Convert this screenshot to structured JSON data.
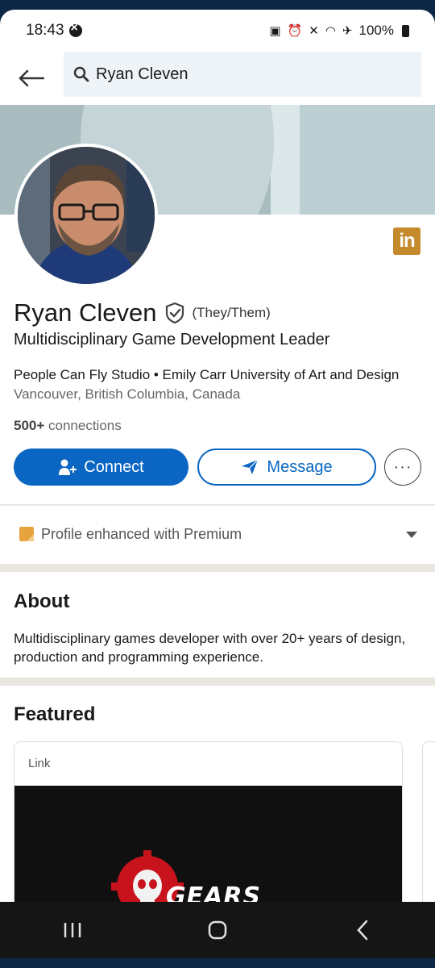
{
  "status_bar": {
    "time": "18:43",
    "battery": "100%"
  },
  "search": {
    "query": "Ryan Cleven"
  },
  "profile": {
    "name": "Ryan Cleven",
    "pronouns": "(They/Them)",
    "headline": "Multidisciplinary Game Development Leader",
    "work": "People Can Fly Studio • Emily Carr University of Art and Design",
    "location": "Vancouver, British Columbia, Canada",
    "connections_count": "500+",
    "connections_label": " connections",
    "linkedin_badge": "in"
  },
  "actions": {
    "connect_label": "Connect",
    "message_label": "Message",
    "more_label": "···"
  },
  "premium": {
    "label": "Profile enhanced with Premium"
  },
  "about": {
    "title": "About",
    "text": "Multidisciplinary games developer with over 20+ years of design, production and programming experience."
  },
  "featured": {
    "title": "Featured",
    "card_label": "Link",
    "card_image_text": "GEARS"
  },
  "colors": {
    "primary": "#0a66c2",
    "premium": "#e7a33e",
    "linkedin_badge": "#c48a2b"
  }
}
